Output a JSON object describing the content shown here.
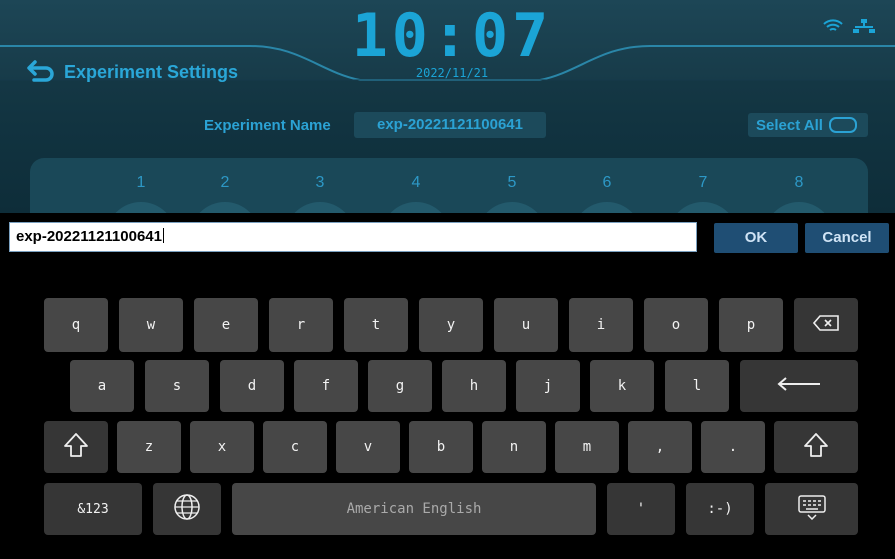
{
  "header": {
    "clock": "10:07",
    "date": "2022/11/21",
    "title": "Experiment Settings"
  },
  "experiment": {
    "name_label": "Experiment Name",
    "name_value": "exp-20221121100641",
    "select_all_label": "Select All"
  },
  "wells": [
    "1",
    "2",
    "3",
    "4",
    "5",
    "6",
    "7",
    "8"
  ],
  "editor": {
    "input_value": "exp-20221121100641",
    "ok_label": "OK",
    "cancel_label": "Cancel"
  },
  "keyboard": {
    "row1": [
      "q",
      "w",
      "e",
      "r",
      "t",
      "y",
      "u",
      "i",
      "o",
      "p"
    ],
    "row2": [
      "a",
      "s",
      "d",
      "f",
      "g",
      "h",
      "j",
      "k",
      "l"
    ],
    "row3": [
      "z",
      "x",
      "c",
      "v",
      "b",
      "n",
      "m",
      ",",
      "."
    ],
    "symbols_label": "&123",
    "space_label": "American English",
    "apostrophe": "'",
    "smiley": ":-)"
  },
  "colors": {
    "accent": "#2ba2d4",
    "key_bg": "#474747",
    "button_bg": "#1f4e74"
  }
}
